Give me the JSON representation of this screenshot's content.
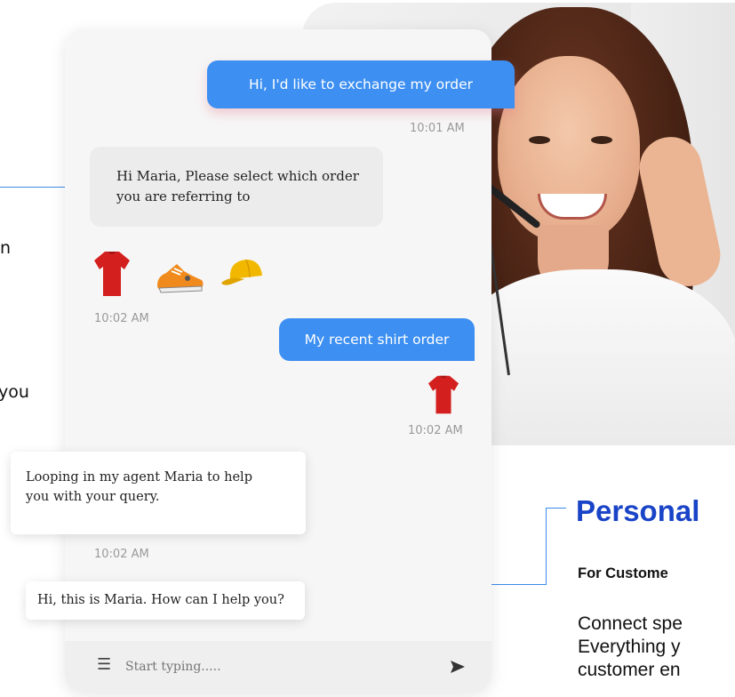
{
  "left_snippets": [
    "n",
    "you"
  ],
  "right_panel": {
    "heading": "Personal",
    "subheading": "For Custome",
    "paragraph_lines": [
      "Connect spe",
      "Everything y",
      "customer en"
    ]
  },
  "chat": {
    "messages": {
      "m1": {
        "text": "Hi, I'd like to exchange my order",
        "time": "10:01 AM"
      },
      "m2": {
        "line1": "Hi Maria, Please select which order",
        "line2": "you are referring to"
      },
      "products_time": "10:02  AM",
      "m3": {
        "text": "My recent shirt order",
        "time": "10:02  AM"
      },
      "m4": {
        "line1": "Looping in my agent Maria to help",
        "line2": "you with your query.",
        "time": "10:02  AM"
      },
      "m5": {
        "text": "Hi, this is Maria. How can I help you?"
      }
    },
    "product_icons": [
      "tshirt-icon",
      "sneaker-icon",
      "cap-icon"
    ],
    "input": {
      "placeholder": "Start typing....."
    }
  },
  "colors": {
    "accent_blue": "#3d8ff2",
    "heading_blue": "#1a44c8",
    "connector": "#3b8bea",
    "shirt_red": "#d3201f"
  }
}
